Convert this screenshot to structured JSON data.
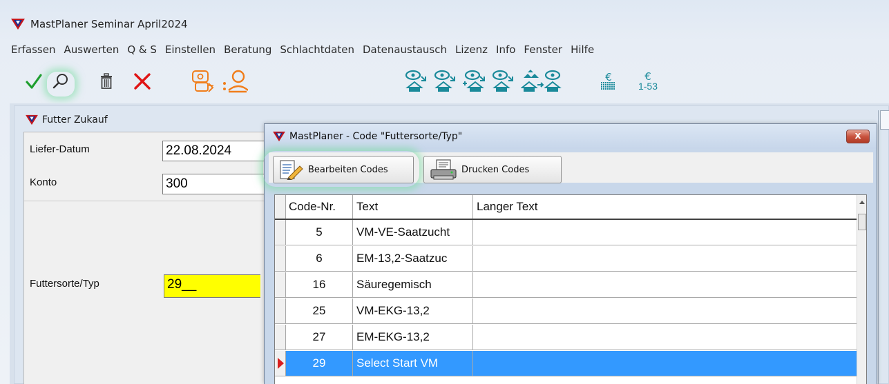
{
  "app": {
    "title": "MastPlaner Seminar April2024"
  },
  "menu": [
    "Erfassen",
    "Auswerten",
    "Q & S",
    "Einstellen",
    "Beratung",
    "Schlachtdaten",
    "Datenaustausch",
    "Lizenz",
    "Info",
    "Fenster",
    "Hilfe"
  ],
  "toolbar": {
    "icons": [
      "check-icon",
      "search-icon",
      "trash-icon",
      "close-x-icon",
      "pig-transfer-icon",
      "search-person-icon",
      "pig-house-out-icon",
      "pig-house-out-icon",
      "pig-house-add-icon",
      "pig-house-out-icon",
      "pig-house-stack-icon",
      "euro-grid-icon",
      "euro-range-icon"
    ],
    "euro_symbol": "€",
    "euro_range_label": "1-53",
    "colors": {
      "check": "#1e9e2e",
      "x": "#e01414",
      "orange": "#f07d1a",
      "teal": "#1a8a9a"
    }
  },
  "child_window": {
    "title": "Futter Zukauf",
    "fields": {
      "liefer_datum_label": "Liefer-Datum",
      "liefer_datum_value": "22.08.2024",
      "konto_label": "Konto",
      "konto_value": "300",
      "futtersorte_label": "Futtersorte/Typ",
      "futtersorte_value": "29__"
    }
  },
  "dialog": {
    "title": "MastPlaner - Code \"Futtersorte/Typ\"",
    "close_label": "x",
    "buttons": {
      "edit": "Bearbeiten Codes",
      "print": "Drucken Codes"
    },
    "grid": {
      "headers": {
        "code": "Code-Nr.",
        "text": "Text",
        "long_text": "Langer Text"
      },
      "rows": [
        {
          "code": "5",
          "text": "VM-VE-Saatzucht",
          "long_text": ""
        },
        {
          "code": "6",
          "text": "EM-13,2-Saatzuc",
          "long_text": ""
        },
        {
          "code": "16",
          "text": "Säuregemisch",
          "long_text": ""
        },
        {
          "code": "25",
          "text": "VM-EKG-13,2",
          "long_text": ""
        },
        {
          "code": "27",
          "text": "EM-EKG-13,2",
          "long_text": ""
        },
        {
          "code": "29",
          "text": "Select Start VM",
          "long_text": ""
        }
      ],
      "selected_code": "29",
      "selection_color": "#3399ff"
    }
  }
}
